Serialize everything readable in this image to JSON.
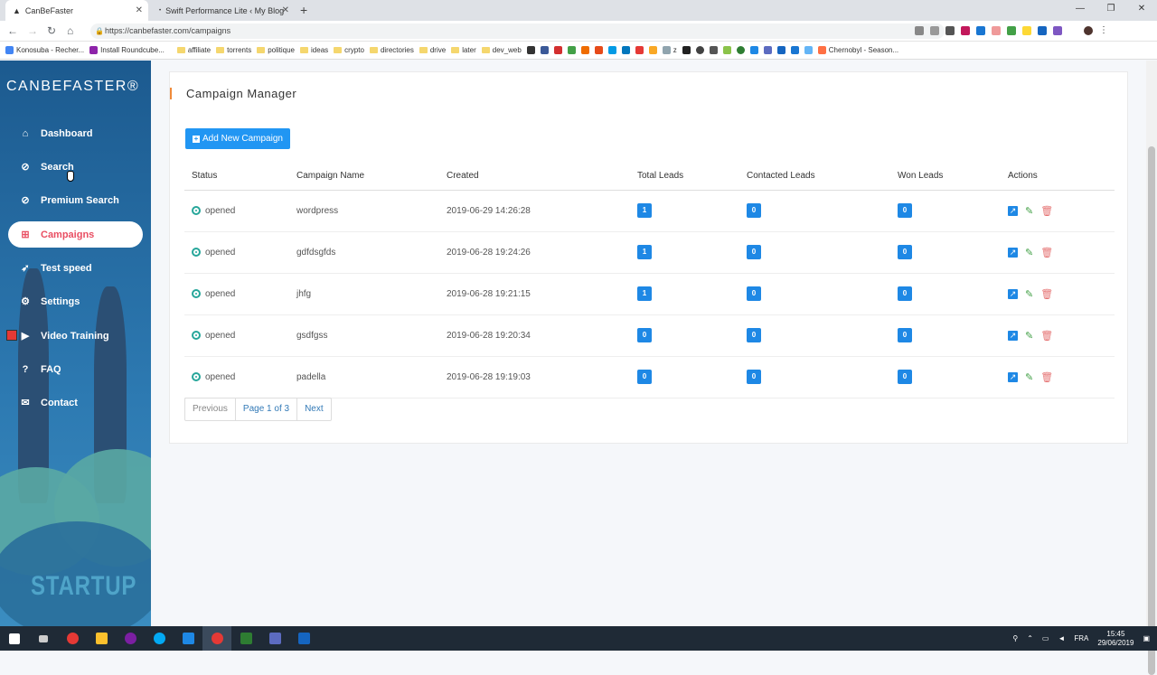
{
  "browser": {
    "tabs": [
      {
        "title": "CanBeFaster"
      },
      {
        "title": "Swift Performance Lite ‹ My Blog"
      }
    ],
    "url": "https://canbefaster.com/campaigns",
    "bookmarks": [
      "Konosuba - Recher...",
      "Install Roundcube...",
      "affiliate",
      "torrents",
      "politique",
      "ideas",
      "crypto",
      "directories",
      "drive",
      "later",
      "dev_web",
      "z",
      "Chernobyl - Season..."
    ]
  },
  "sidebar": {
    "logo": "CANBEFASTER®",
    "items": [
      {
        "label": "Dashboard",
        "icon": "home-icon"
      },
      {
        "label": "Search",
        "icon": "compass-icon"
      },
      {
        "label": "Premium Search",
        "icon": "compass-icon"
      },
      {
        "label": "Campaigns",
        "icon": "grid-icon"
      },
      {
        "label": "Test speed",
        "icon": "rocket-icon"
      },
      {
        "label": "Settings",
        "icon": "gear-icon"
      },
      {
        "label": "Video Training",
        "icon": "video-icon"
      },
      {
        "label": "FAQ",
        "icon": "help-icon"
      },
      {
        "label": "Contact",
        "icon": "mail-icon"
      }
    ],
    "startup": "STARTUP"
  },
  "main": {
    "title": "Campaign Manager",
    "add_button": "Add New Campaign",
    "columns": [
      "Status",
      "Campaign Name",
      "Created",
      "Total Leads",
      "Contacted Leads",
      "Won Leads",
      "Actions"
    ],
    "rows": [
      {
        "status": "opened",
        "name": "wordpress",
        "created": "2019-06-29 14:26:28",
        "total": "1",
        "contacted": "0",
        "won": "0"
      },
      {
        "status": "opened",
        "name": "gdfdsgfds",
        "created": "2019-06-28 19:24:26",
        "total": "1",
        "contacted": "0",
        "won": "0"
      },
      {
        "status": "opened",
        "name": "jhfg",
        "created": "2019-06-28 19:21:15",
        "total": "1",
        "contacted": "0",
        "won": "0"
      },
      {
        "status": "opened",
        "name": "gsdfgss",
        "created": "2019-06-28 19:20:34",
        "total": "0",
        "contacted": "0",
        "won": "0"
      },
      {
        "status": "opened",
        "name": "padella",
        "created": "2019-06-28 19:19:03",
        "total": "0",
        "contacted": "0",
        "won": "0"
      }
    ],
    "pager": {
      "previous": "Previous",
      "page": "Page 1 of 3",
      "next": "Next"
    }
  },
  "taskbar": {
    "lang": "FRA",
    "time": "15:45",
    "date": "29/06/2019"
  },
  "colors": {
    "accent": "#e94e62",
    "primary": "#2196f3",
    "badge": "#1e88e5",
    "status": "#26a69a"
  }
}
